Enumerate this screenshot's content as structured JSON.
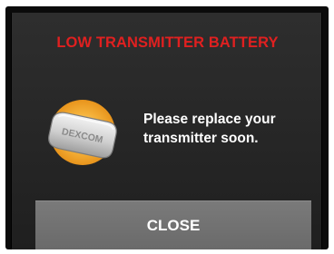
{
  "alert": {
    "title": "LOW TRANSMITTER BATTERY",
    "title_color": "#e02020",
    "message_line1": "Please replace your",
    "message_line2": "transmitter soon.",
    "icon": "transmitter-icon",
    "icon_brand_text": "DEXCOM"
  },
  "buttons": {
    "close_label": "CLOSE"
  }
}
